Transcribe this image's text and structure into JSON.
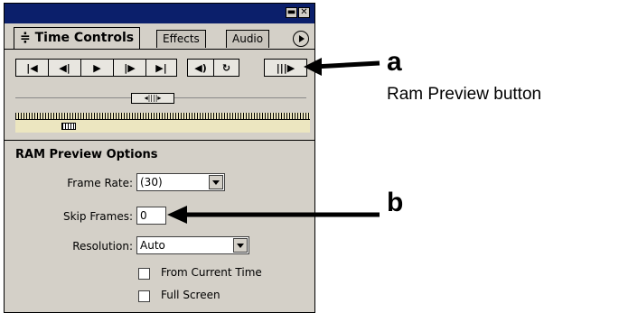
{
  "window": {
    "minimize_glyph": "▬",
    "close_glyph": "✕"
  },
  "tabs": [
    {
      "label": "Time Controls",
      "prefix_glyph": "≑"
    },
    {
      "label": "Effects"
    },
    {
      "label": "Audio"
    }
  ],
  "transport": {
    "first_frame": "|◀",
    "prev_frame": "◀|",
    "play": "▶",
    "next_frame": "|▶",
    "last_frame": "▶|",
    "audio": "◀)",
    "loop": "↻",
    "ram_preview": "|||▶"
  },
  "ram_preview_options": {
    "title": "RAM Preview Options",
    "frame_rate": {
      "label": "Frame Rate:",
      "value": "(30)"
    },
    "skip_frames": {
      "label": "Skip Frames:",
      "value": "0"
    },
    "resolution": {
      "label": "Resolution:",
      "value": "Auto"
    },
    "from_current_time": {
      "label": "From Current Time",
      "checked": false
    },
    "full_screen": {
      "label": "Full Screen",
      "checked": false
    }
  },
  "callouts": {
    "a": {
      "letter": "a",
      "description": "Ram Preview button"
    },
    "b": {
      "letter": "b"
    }
  },
  "icons": [
    "minimize-icon",
    "close-icon",
    "palette-menu-icon",
    "first-frame-icon",
    "previous-frame-icon",
    "play-icon",
    "next-frame-icon",
    "last-frame-icon",
    "audio-icon",
    "loop-icon",
    "ram-preview-icon",
    "dropdown-arrow-icon"
  ]
}
